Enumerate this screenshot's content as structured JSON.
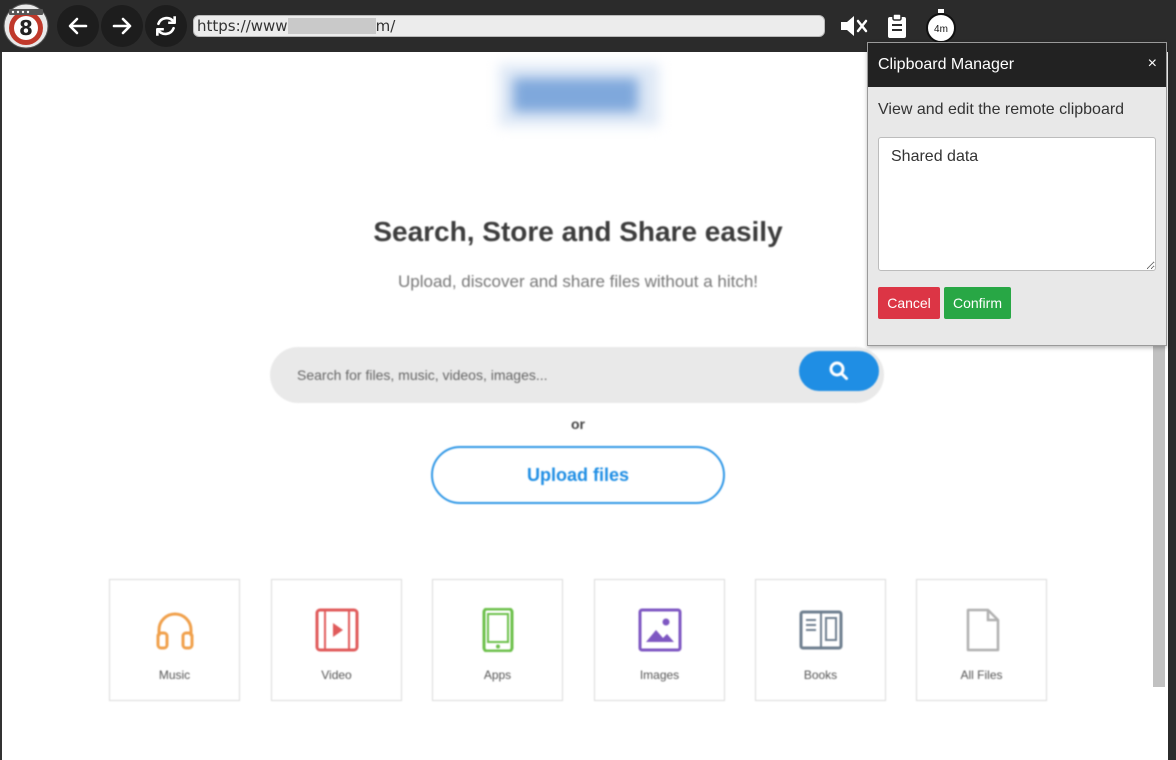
{
  "browser": {
    "url_prefix": "https://www",
    "url_suffix": "m/",
    "timer": "4m",
    "icons": {
      "logo": "app-logo-8",
      "back": "arrow-left-icon",
      "forward": "arrow-right-icon",
      "reload": "reload-icon",
      "mute": "speaker-mute-icon",
      "clipboard": "clipboard-icon",
      "timer": "stopwatch-icon"
    }
  },
  "hero": {
    "title": "Search, Store and Share easily",
    "subtitle": "Upload, discover and share files without a hitch!"
  },
  "search": {
    "placeholder": "Search for files, music, videos, images..."
  },
  "or_label": "or",
  "upload_label": "Upload files",
  "categories": [
    {
      "label": "Music",
      "icon": "headphones-icon",
      "color": "#f0a04b"
    },
    {
      "label": "Video",
      "icon": "video-icon",
      "color": "#e05a5a"
    },
    {
      "label": "Apps",
      "icon": "tablet-icon",
      "color": "#6cc04a"
    },
    {
      "label": "Images",
      "icon": "image-icon",
      "color": "#7e57c2"
    },
    {
      "label": "Books",
      "icon": "book-icon",
      "color": "#6f7f8f"
    },
    {
      "label": "All Files",
      "icon": "file-icon",
      "color": "#b0b0b0"
    }
  ],
  "clipboard": {
    "title": "Clipboard Manager",
    "close": "×",
    "description": "View and edit the remote clipboard",
    "content": "Shared data",
    "cancel": "Cancel",
    "confirm": "Confirm"
  },
  "colors": {
    "accent": "#1f8ee4",
    "cancel": "#dc3545",
    "confirm": "#28a745",
    "topbar": "#2b2b2b"
  }
}
